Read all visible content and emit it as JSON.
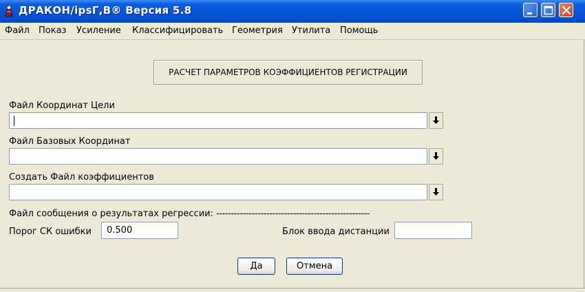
{
  "window": {
    "title": "ДРАКОН/ipsГ,В® Версия  5.8"
  },
  "menu": [
    "Файл",
    "Показ",
    "Усиление",
    "Классифицировать",
    "Геометрия",
    "Утилита",
    "Помощь"
  ],
  "header": "РАСЧЕТ ПАРАМЕТРОВ КОЭФФИЦИЕНТОВ РЕГИСТРАЦИИ",
  "fields": {
    "target": {
      "label": "Файл Координат Цели",
      "value": ""
    },
    "base": {
      "label": "Файл Базовых Координат",
      "value": ""
    },
    "coeff": {
      "label": "Создать Файл коэффициентов",
      "value": ""
    }
  },
  "report_label": "Файл сообщения о результатах регрессии:",
  "report_value": "----------------------------------------------------",
  "threshold": {
    "label": "Порог СК ошибки",
    "value": "0.500"
  },
  "distance": {
    "label": "Блок ввода дистанции",
    "value": ""
  },
  "buttons": {
    "ok": "Да",
    "cancel": "Отмена"
  },
  "icons": {
    "app": "dragon-app-icon",
    "minimize": "minimize-icon",
    "maximize": "maximize-icon",
    "close": "close-icon",
    "dropdown": "down-arrow-icon"
  },
  "colors": {
    "titlebar": "#0756d8",
    "close_button": "#c8401c",
    "background": "#ece9d8"
  }
}
